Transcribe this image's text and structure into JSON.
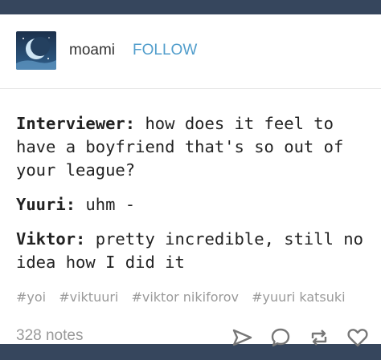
{
  "post": {
    "blog_name": "moami",
    "follow_label": "FOLLOW",
    "avatar_icon": "crescent-moon-avatar-icon",
    "dialogue": [
      {
        "speaker": "Interviewer:",
        "text": " how does it feel to have a boyfriend that's so out of your league?"
      },
      {
        "speaker": "Yuuri:",
        "text": " uhm -"
      },
      {
        "speaker": "Viktor:",
        "text": " pretty incredible, still no idea how I did it"
      }
    ],
    "tags": [
      "#yoi",
      "#viktuuri",
      "#viktor nikiforov",
      "#yuuri katsuki"
    ],
    "notes": "328 notes",
    "action_icons": [
      "share-icon",
      "reply-icon",
      "reblog-icon",
      "like-icon"
    ]
  },
  "colors": {
    "background": "#36465d",
    "card": "#ffffff",
    "follow": "#529ecc",
    "muted": "#999999"
  }
}
